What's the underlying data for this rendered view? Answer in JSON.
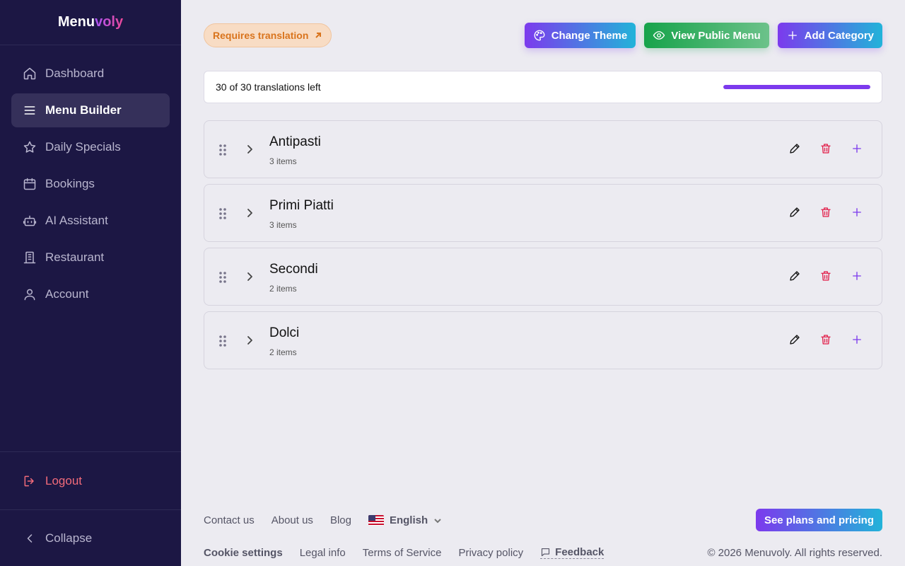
{
  "brand": {
    "name_main": "Menu",
    "name_accent": "voly"
  },
  "sidebar": {
    "items": [
      {
        "label": "Dashboard",
        "icon": "home-icon"
      },
      {
        "label": "Menu Builder",
        "icon": "menu-lines-icon",
        "active": true
      },
      {
        "label": "Daily Specials",
        "icon": "star-icon"
      },
      {
        "label": "Bookings",
        "icon": "calendar-icon"
      },
      {
        "label": "AI Assistant",
        "icon": "robot-icon"
      },
      {
        "label": "Restaurant",
        "icon": "building-icon"
      },
      {
        "label": "Account",
        "icon": "user-icon"
      }
    ],
    "logout_label": "Logout",
    "collapse_label": "Collapse"
  },
  "header": {
    "requires_translation": "Requires translation",
    "change_theme": "Change Theme",
    "view_public_menu": "View Public Menu",
    "add_category": "Add Category"
  },
  "translations": {
    "text": "30 of 30 translations left",
    "progress_fraction": 1.0
  },
  "categories": [
    {
      "name": "Antipasti",
      "count": "3 items"
    },
    {
      "name": "Primi Piatti",
      "count": "3 items"
    },
    {
      "name": "Secondi",
      "count": "2 items"
    },
    {
      "name": "Dolci",
      "count": "2 items"
    }
  ],
  "footer": {
    "contact": "Contact us",
    "about": "About us",
    "blog": "Blog",
    "language": "English",
    "plans": "See plans and pricing",
    "cookie": "Cookie settings",
    "legal": "Legal info",
    "terms": "Terms of Service",
    "privacy": "Privacy policy",
    "feedback": "Feedback",
    "copyright": "© 2026 Menuvoly. All rights reserved."
  },
  "colors": {
    "sidebar_bg": "#1c1744",
    "accent": "#7c3aed",
    "danger": "#e11d48",
    "success": "#16a34a",
    "warning": "#d9741d"
  }
}
